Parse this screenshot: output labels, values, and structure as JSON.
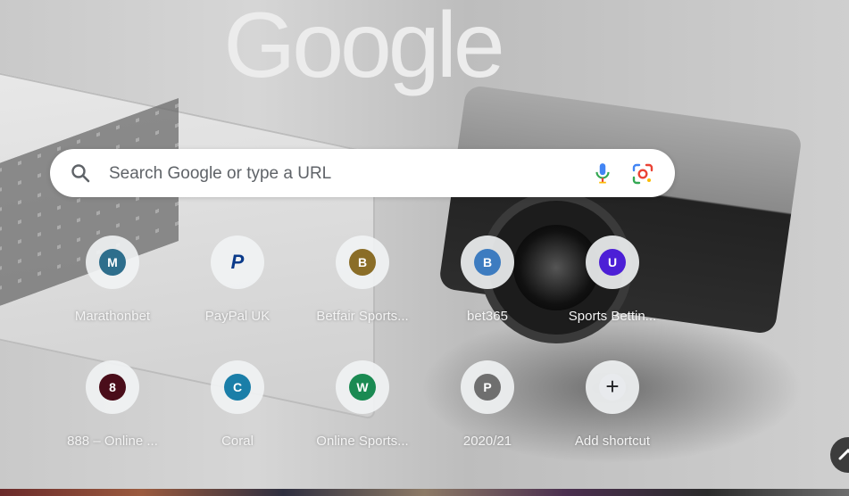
{
  "logo": {
    "text": "Google"
  },
  "search": {
    "placeholder": "Search Google or type a URL"
  },
  "shortcuts": [
    {
      "letter": "M",
      "title": "Marathonbet",
      "color": "#2e6e8c"
    },
    {
      "letter": "P",
      "title": "PayPal UK",
      "color": "#0a3a8a"
    },
    {
      "letter": "B",
      "title": "Betfair Sports...",
      "color": "#8a6d27"
    },
    {
      "letter": "B",
      "title": "bet365",
      "color": "#3d7cc0"
    },
    {
      "letter": "U",
      "title": "Sports Bettin...",
      "color": "#4c1fd6"
    },
    {
      "letter": "8",
      "title": "888 – Online ...",
      "color": "#4a0d1a"
    },
    {
      "letter": "C",
      "title": "Coral",
      "color": "#1a7ea8"
    },
    {
      "letter": "W",
      "title": "Online Sports...",
      "color": "#1a8a52"
    },
    {
      "letter": "P",
      "title": "2020/21",
      "color": "#6f6f6f"
    },
    {
      "letter": "+",
      "title": "Add shortcut",
      "color": "#e8eaed"
    }
  ],
  "icons": {
    "search": "search-icon",
    "mic": "microphone-icon",
    "lens": "google-lens-icon",
    "scroll": "chevron-up-icon"
  }
}
